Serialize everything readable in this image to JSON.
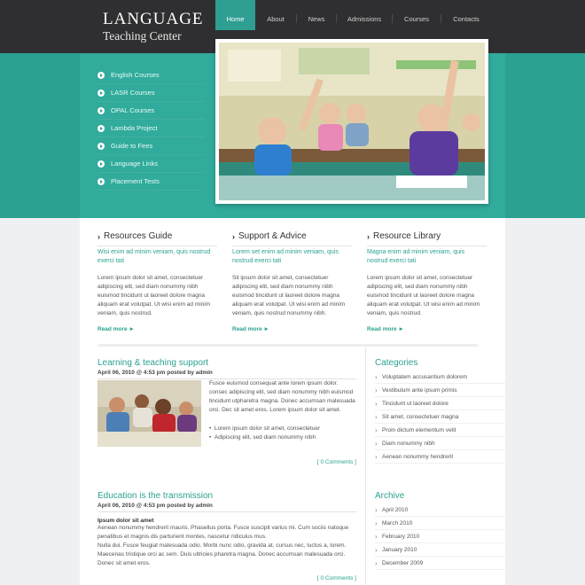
{
  "logo": {
    "line1": "LANGUAGE",
    "line2": "Teaching Center"
  },
  "nav": [
    "Home",
    "About",
    "News",
    "Admissions",
    "Courses",
    "Contacts"
  ],
  "side_menu": [
    "English Courses",
    "LASR Courses",
    "OPAL Courses",
    "Lambda Project",
    "Guide to Fees",
    "Language Links",
    "Placement Tests"
  ],
  "columns": [
    {
      "title": "Resources Guide",
      "sub": "Wisi enim ad minim veniam, quis nostrud exerci tati",
      "body": "Lorem ipsum dolor sit amet, consectetuer adipiscing elit, sed diam nonummy nibh euismod tincidunt ut laoreet dolore magna aliquam erat volutpat. Ut wisi enim ad minim veniam, quis nostrud.",
      "more": "Read more ►"
    },
    {
      "title": "Support & Advice",
      "sub": "Lorem set enim ad minim veniam, quis nostrud exerci tati",
      "body": "Sit ipsum dolor sit amet, consectetuer adipiscing elit, sed diam nonummy nibh euismod tincidunt ut laoreet dolore magna aliquam erat volutpat. Ut wisi enim ad minim veniam, quis nostrud nonummy nibh.",
      "more": "Read more ►"
    },
    {
      "title": "Resource Library",
      "sub": "Magna enim ad minim veniam, quis nostrud exerci tati",
      "body": "Lorem ipsum dolor sit amet, consectetuer adipiscing elit, sed diam nonummy nibh euismod tincidunt ut laoreet dolore magna aliquam erat volutpat. Ut wisi enim ad minim veniam, quis nostrud.",
      "more": "Read more ►"
    }
  ],
  "posts": [
    {
      "title": "Learning & teaching support",
      "meta": "April 06, 2010 @ 4:53 pm posted by admin",
      "text": "Fusce euismod consequat ante lorem ipsum dolor. consec adipiscing elit, sed diam nonummy nibh euismod tincidunt utpharetra magna. Donec accumsan malesuada orci. Dec sit amet eros. Lorem ipsum dolor sit amet.",
      "bullets": [
        "Lorem ipsum dolor sit amet, consectetuer",
        "Adipiscing elit, sed diam nonummy nibh"
      ],
      "comments": "[ 0 Comments ]"
    },
    {
      "title": "Education is the transmission",
      "meta": "April 06, 2010 @ 4:53 pm posted by admin",
      "lead": "Ipsum dolor sit amet",
      "text": "Aenean nonummy hendrerit mauris. Phasellus porta. Fusce suscipit varius mi. Cum sociis natoque penatibus et magnis dis parturient montes, nascetur ridiculus mus.\nNulla dui. Fusce feugiat malesuada odio. Morbi nunc odio, gravida at, cursus nec, luctus a, lorem. Maecenas tristique orci ac sem. Duis ultricies pharetra magna. Donec accumsan malesuada orci. Donec sit amet eros.",
      "comments": "[ 0 Comments ]"
    }
  ],
  "categories": {
    "title": "Categories",
    "items": [
      "Voluptatem accusantium dolorem",
      "Vestibulum ante ipsum primis",
      "Tincidunt ut laoreet dolore",
      "Sit amet, consectetuer magna",
      "Proin dictum elementum velit",
      "Diam nonummy nibh",
      "Aenean nonummy hendrerit"
    ]
  },
  "archive": {
    "title": "Archive",
    "items": [
      "April 2010",
      "March 2010",
      "February 2010",
      "January 2010",
      "December 2009"
    ]
  }
}
